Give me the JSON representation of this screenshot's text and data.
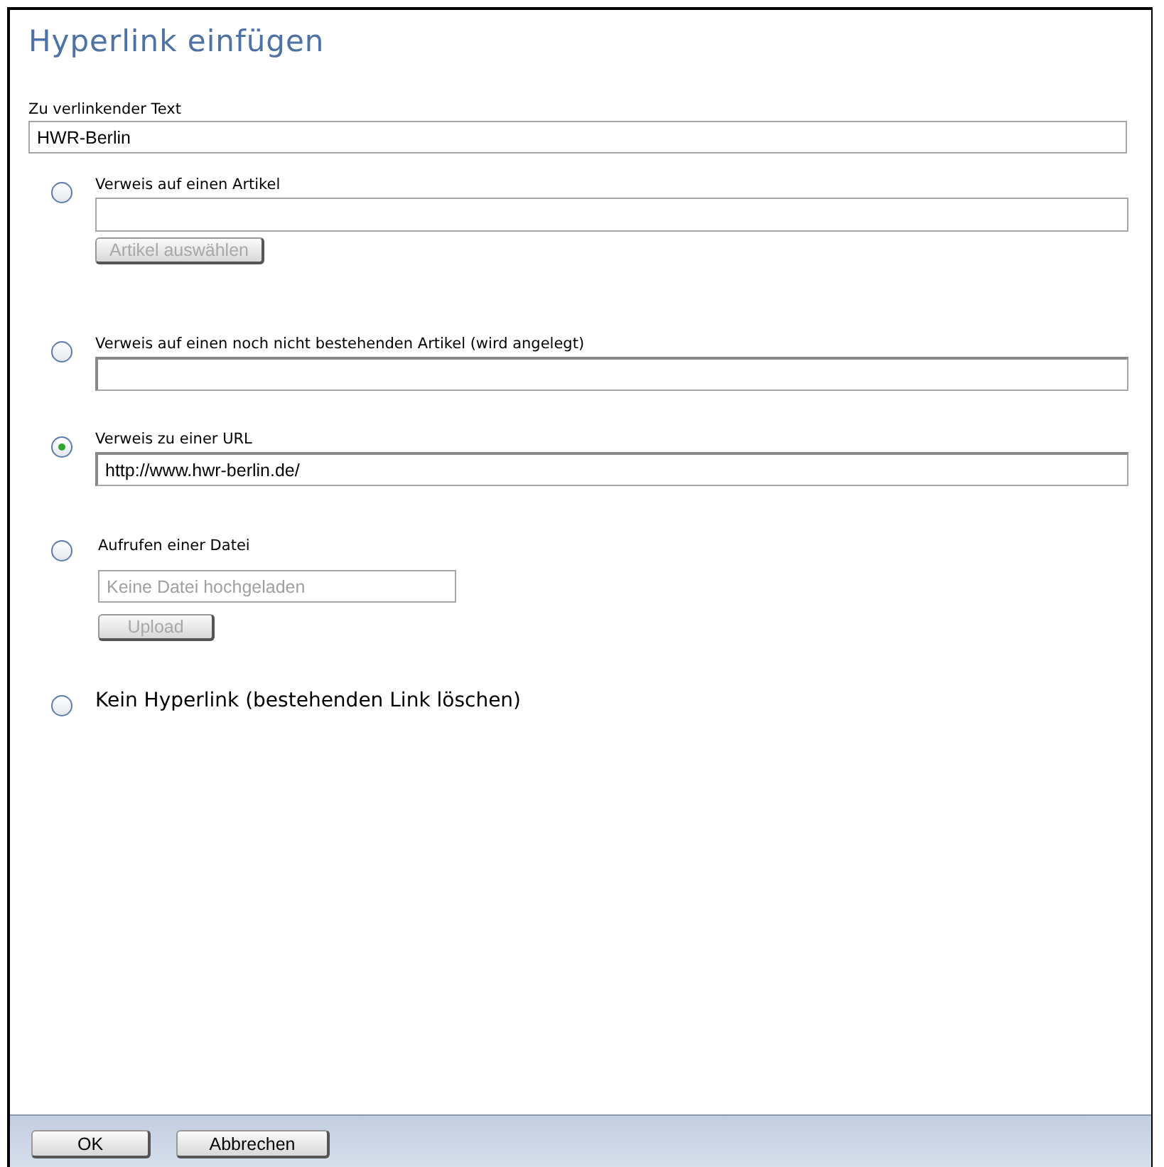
{
  "title": "Hyperlink einfügen",
  "link_text": {
    "label": "Zu verlinkender Text",
    "value": "HWR-Berlin"
  },
  "options": [
    {
      "kind": "input",
      "label": "Verweis auf einen Artikel",
      "selected": false,
      "button": {
        "label": "Artikel auswählen",
        "disabled": true
      }
    },
    {
      "kind": "input",
      "label": "Verweis auf einen noch nicht bestehenden Artikel (wird angelegt)",
      "selected": false
    },
    {
      "kind": "input",
      "label": "Verweis zu einer URL",
      "selected": true,
      "value": "http://www.hwr-berlin.de/"
    },
    {
      "kind": "file",
      "label": "Aufrufen einer Datei",
      "selected": false,
      "placeholder": "Keine Datei hochgeladen",
      "button": {
        "label": "Upload",
        "disabled": true
      }
    },
    {
      "kind": "plain",
      "label": "Kein Hyperlink (bestehenden Link löschen)",
      "selected": false
    }
  ],
  "buttons": [
    {
      "label": "OK"
    },
    {
      "label": "Abbrechen"
    }
  ]
}
